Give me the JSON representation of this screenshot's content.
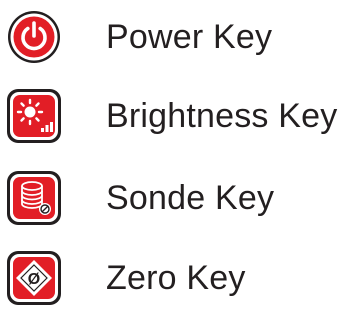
{
  "keys": [
    {
      "label": "Power Key",
      "icon": "power-icon"
    },
    {
      "label": "Brightness Key",
      "icon": "brightness-icon"
    },
    {
      "label": "Sonde Key",
      "icon": "sonde-icon"
    },
    {
      "label": "Zero Key",
      "icon": "zero-icon",
      "icon_text": "Ø"
    }
  ],
  "colors": {
    "icon_red": "#e21e26",
    "icon_dark": "#231f20",
    "label_text": "#231f20",
    "background": "#ffffff"
  }
}
